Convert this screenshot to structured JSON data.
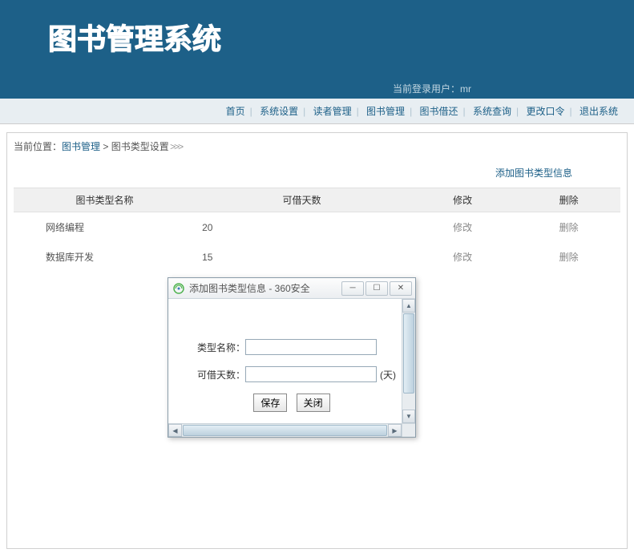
{
  "header": {
    "logo": "图书管理系统"
  },
  "user_bar": {
    "label": "当前登录用户：",
    "user": "mr"
  },
  "nav": {
    "items": [
      "首页",
      "系统设置",
      "读者管理",
      "图书管理",
      "图书借还",
      "系统查询",
      "更改口令",
      "退出系统"
    ]
  },
  "breadcrumb": {
    "prefix": "当前位置：",
    "link": "图书管理",
    "sep": " > ",
    "current": "图书类型设置",
    "arrows": " >>>"
  },
  "action": {
    "add_link": "添加图书类型信息"
  },
  "table": {
    "headers": [
      "图书类型名称",
      "可借天数",
      "修改",
      "删除"
    ],
    "rows": [
      {
        "name": "网络编程",
        "days": "20",
        "edit": "修改",
        "del": "删除"
      },
      {
        "name": "数据库开发",
        "days": "15",
        "edit": "修改",
        "del": "删除"
      }
    ]
  },
  "dialog": {
    "title": "添加图书类型信息 - 360安全",
    "form": {
      "label_name": "类型名称：",
      "label_days": "可借天数：",
      "unit": "(天)",
      "btn_save": "保存",
      "btn_close": "关闭"
    }
  }
}
